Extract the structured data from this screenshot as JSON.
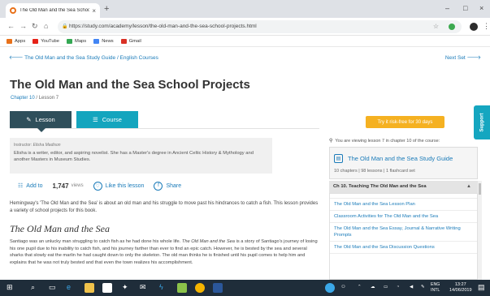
{
  "browser": {
    "tab_title": "The Old Man and the Sea School",
    "tab_close": "×",
    "new_tab": "+",
    "win_min": "–",
    "win_max": "□",
    "win_close": "×",
    "url": "https://study.com/academy/lesson/the-old-man-and-the-sea-school-projects.html",
    "bookmarks": [
      {
        "label": "Apps",
        "color": "#e8711a"
      },
      {
        "label": "YouTube",
        "color": "#e62117"
      },
      {
        "label": "Maps",
        "color": "#34a853"
      },
      {
        "label": "News",
        "color": "#4285f4"
      },
      {
        "label": "Gmail",
        "color": "#d93025"
      }
    ]
  },
  "page": {
    "breadcrumb": "The Old Man and the Sea Study Guide / English Courses",
    "next_step": "Next Set",
    "title": "The Old Man and the Sea School Projects",
    "chapter_link": "Chapter 10",
    "lesson_num": "/ Lesson 7",
    "tab_lesson": "Lesson",
    "tab_course": "Course",
    "cta": "Try it risk-free for 30 days",
    "support": "Support",
    "instructor_label": "Instructor:",
    "instructor_name": "Elisha Madison",
    "instructor_bio": "Elisha is a writer, editor, and aspiring novelist. She has a Master's degree in Ancient Celtic History & Mythology and another Masters in Museum Studies.",
    "add_to": "Add to",
    "views_count": "1,747",
    "views_label": "views",
    "like": "Like this lesson",
    "share": "Share",
    "intro": "Hemingway's 'The Old Man and the Sea' is about an old man and his struggle to move past his hindrances to catch a fish. This lesson provides a variety of school projects for this book.",
    "section_heading": "The Old Man and the Sea",
    "body_a": "Santiago was an unlucky man struggling to catch fish as he had done his whole life. ",
    "body_em": "The Old Man and the Sea",
    "body_b": " is a story of Santiago's journey of losing his one pupil due to his inability to catch fish, and his journey farther than ever to find an epic catch. However, he is bested by the sea and several sharks that slowly eat the marlin he had caught down to only the skeleton. The old man thinks he is finished until his pupil comes to help him and explains that he was not truly bested and that even the town realizes his accomplishment."
  },
  "sidebar": {
    "viewing_note": "You are viewing lesson 7 in chapter 10 of the course:",
    "course_name": "The Old Man and the Sea Study Guide",
    "course_meta": "10 chapters | 98 lessons | 1 flashcard set",
    "chapter_heading": "Ch 10. Teaching The Old Man and the Sea",
    "items": [
      {
        "label": "The Old Man and the Sea Lesson Plan"
      },
      {
        "label": "Classroom Activities for The Old Man and the Sea"
      },
      {
        "label": "The Old Man and the Sea Essay, Journal & Narrative Writing Prompts"
      },
      {
        "label": "The Old Man and the Sea Discussion Questions"
      }
    ]
  },
  "taskbar": {
    "lang_top": "ENG",
    "lang_bottom": "INTL",
    "time": "13:27",
    "date": "14/06/2019"
  }
}
